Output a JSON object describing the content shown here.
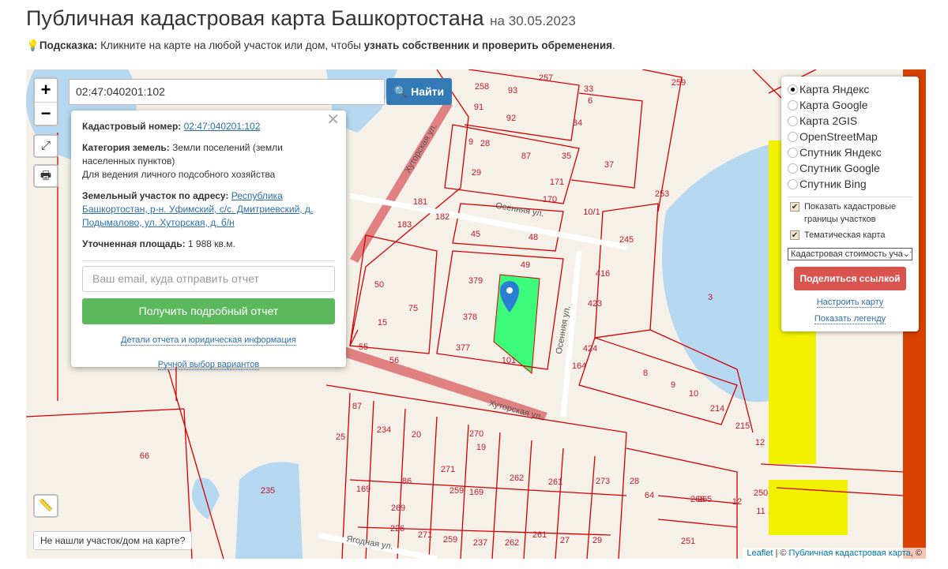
{
  "header": {
    "title": "Публичная кадастровая карта Башкортостана",
    "date": "на 30.05.2023"
  },
  "hint": {
    "icon": "lightbulb-icon",
    "label": "Подсказка:",
    "text1": " Кликните на карте на любой участок или дом, чтобы ",
    "bold": "узнать собственник и проверить обременения",
    "end": "."
  },
  "search": {
    "value": "02:47:040201:102",
    "button": "Найти"
  },
  "zoom": {
    "in": "+",
    "out": "−"
  },
  "popup": {
    "cad_label": "Кадастровый номер:",
    "cad_value": "02:47:040201:102",
    "cat_label": "Категория земель:",
    "cat_value": " Земли поселений (земли населенных пунктов)",
    "use": "Для ведения личного подсобного хозяйства",
    "addr_label": "Земельный участок по адресу:",
    "addr_value": "Республика Башкортостан, р-н. Уфимский, с/с. Дмитриевский, д. Подымалово, ул. Хуторская, д. б/н",
    "area_label": "Уточненная площадь:",
    "area_value": " 1 988 кв.м.",
    "email_placeholder": "Ваш email, куда отправить отчет",
    "get_report": "Получить подробный отчет",
    "details_link": "Детали отчета и юридическая информация",
    "manual_link": "Ручной выбор вариантов"
  },
  "layers": {
    "base": [
      {
        "label": "Карта Яндекс",
        "checked": true
      },
      {
        "label": "Карта Google"
      },
      {
        "label": "Карта 2GIS"
      },
      {
        "label": "OpenStreetMap"
      },
      {
        "label": "Спутник Яндекс"
      },
      {
        "label": "Спутник Google"
      },
      {
        "label": "Спутник Bing"
      }
    ],
    "show_borders": "Показать кадастровые границы участков",
    "thematic": "Тематическая карта",
    "select_value": "Кадастровая стоимость участков",
    "share": "Поделиться ссылкой",
    "configure": "Настроить карту",
    "legend": "Показать легенду"
  },
  "not_found": "Не нашли участок/дом на карте?",
  "attribution": {
    "leaflet": "Leaflet",
    "sep": " | © ",
    "pkk": "Публичная кадастровая карта",
    "rest": ", ©"
  },
  "map_labels": [
    "258",
    "93",
    "257",
    "33",
    "6",
    "259",
    "91",
    "92",
    "34",
    "9",
    "28",
    "87",
    "35",
    "37",
    "29",
    "171",
    "170",
    "253",
    "181",
    "183",
    "182",
    "45",
    "48",
    "10/1",
    "245",
    "49",
    "416",
    "50",
    "75",
    "379",
    "378",
    "423",
    "3",
    "15",
    "377",
    "101",
    "424",
    "164",
    "55",
    "56",
    "8",
    "9",
    "10",
    "214",
    "215",
    "12",
    "87",
    "234",
    "20",
    "270",
    "19",
    "25",
    "262",
    "261",
    "273",
    "64",
    "66",
    "235",
    "86",
    "169",
    "269",
    "271",
    "259",
    "169",
    "226",
    "271",
    "259",
    "237",
    "262",
    "261",
    "27",
    "29",
    "251",
    "11",
    "12",
    "250",
    "265",
    "266",
    "28"
  ],
  "street_labels": [
    "Хуторская ул.",
    "Осенняя ул.",
    "Осенняя ул.",
    "Хуторская ул.",
    "Ягодная ул."
  ],
  "colors": {
    "accent": "#337ab7",
    "report": "#5cb85c",
    "share": "#d9534f",
    "parcel": "#3dfb7a",
    "border": "#d40000",
    "water": "#b5d8f0"
  }
}
